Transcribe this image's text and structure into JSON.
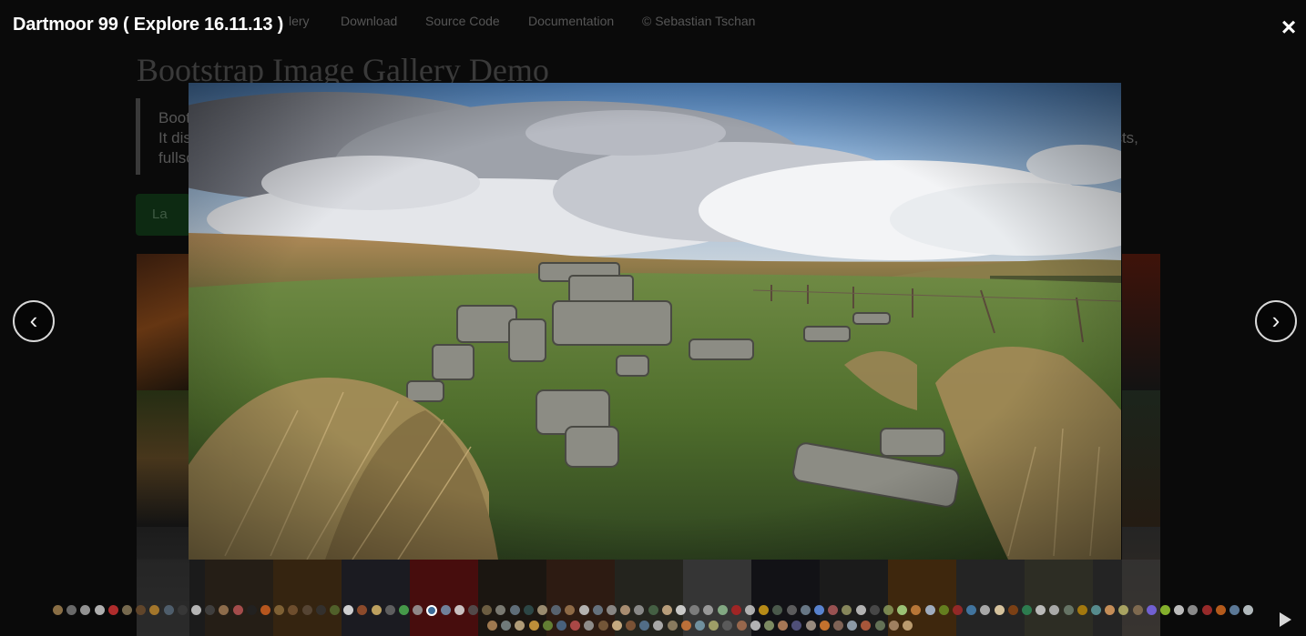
{
  "background_page": {
    "nav": [
      "lery",
      "Download",
      "Source Code",
      "Documentation",
      "© Sebastian Tschan"
    ],
    "title": "Bootstrap Image Gallery Demo",
    "description_fragments": [
      "Boot",
      "It dis",
      "fullsc",
      "ects,"
    ],
    "button_fragment": "La"
  },
  "lightbox": {
    "title": "Dartmoor 99 ( Explore 16.11.13 )",
    "close_label": "×",
    "prev_label": "‹",
    "next_label": "›",
    "close_icon": "close-icon",
    "prev_icon": "chevron-left-icon",
    "next_icon": "chevron-right-icon",
    "play_icon": "play-icon",
    "image_alt": "Dartmoor 99 ( Explore 16.11.13 )",
    "active_indicator": 27,
    "indicator_colors_row1": [
      "#a08050",
      "#7a7a7a",
      "#aaa",
      "#ccc",
      "#c33",
      "#8a7a5a",
      "#6a4a2a",
      "#b8842c",
      "#556677",
      "#3a3a3a",
      "#cfcfcf",
      "#444",
      "#a07a55",
      "#b55",
      "#222",
      "#d06020",
      "#8b6b3b",
      "#775533",
      "#5a4a3a",
      "#333",
      "#556b2f",
      "#eee",
      "#a0522d",
      "#d9b76a",
      "#6a6a6a",
      "#4caf50",
      "#9e9e9e",
      "#3d6c99",
      "#7896b4",
      "#e0e0e0",
      "#555",
      "#7a6a4a",
      "#8b8b83",
      "#6b7c8b",
      "#2f4f4f",
      "#b0a080",
      "#607080",
      "#a07850",
      "#cdcdcd",
      "#708090",
      "#999",
      "#c0a080",
      "#9a9a9a",
      "#4a6a4a",
      "#d2b48c",
      "#e5e5e5",
      "#888",
      "#a9a9a9",
      "#8fbc8f",
      "#b22222",
      "#c8c8c8",
      "#d4a017",
      "#556655",
      "#696969",
      "#778899",
      "#6495ed",
      "#ae5a5a",
      "#999966",
      "#cccccc",
      "#4f4f4f",
      "#8a9a5b",
      "#ad8",
      "#cd853f",
      "#b0c4de",
      "#6b8e23",
      "#a52a2a",
      "#4682b4",
      "#bebebe",
      "#f5deb3",
      "#8b4513",
      "#2e8b57",
      "#d3d3d3",
      "#c0c0c0",
      "#708070",
      "#b8860b",
      "#5f9ea0",
      "#e0a060",
      "#bdb76b",
      "#8b7355",
      "#7b68ee",
      "#9acd32",
      "#dcdcdc",
      "#a0a0a0",
      "#b03030",
      "#d2691e",
      "#6a8caf",
      "#cfd8dc"
    ],
    "indicator_colors_row2": [
      "#b58a5a",
      "#7f8c8d",
      "#c9b38a",
      "#d9a441",
      "#6d8f3a",
      "#4d6d8f",
      "#c05050",
      "#a0a0a0",
      "#806040",
      "#e0c090",
      "#8a5a3a",
      "#5a7a9a",
      "#c0c0c0",
      "#9a8a6a",
      "#d47a3a",
      "#7aa0b0",
      "#b0b070",
      "#606060",
      "#a87050",
      "#d0d0d0",
      "#8fa070",
      "#c08860",
      "#5a5a8a",
      "#b0a090",
      "#e08030",
      "#907060",
      "#a0b0c0",
      "#c06040",
      "#708060",
      "#b09070",
      "#d0b080"
    ]
  }
}
